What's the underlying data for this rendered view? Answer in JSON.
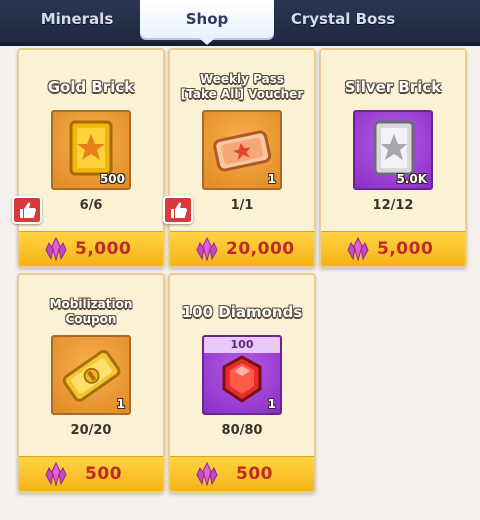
{
  "tabs": [
    {
      "label": "Minerals",
      "active": false
    },
    {
      "label": "Shop",
      "active": true
    },
    {
      "label": "Crystal Boss",
      "active": false
    }
  ],
  "items": [
    {
      "title": "Gold Brick",
      "icon": "gold-brick-icon",
      "quantity": "500",
      "stock": "6/6",
      "price": "5,000",
      "recommended": true
    },
    {
      "title_lines": [
        "Weekly Pass",
        "[Take All] Voucher"
      ],
      "icon": "voucher-ticket-icon",
      "quantity": "1",
      "stock": "1/1",
      "price": "20,000",
      "recommended": true
    },
    {
      "title": "Silver Brick",
      "icon": "silver-brick-icon",
      "quantity": "5.0K",
      "stock": "12/12",
      "price": "5,000",
      "recommended": false
    },
    {
      "title_lines": [
        "Mobilization",
        "Coupon"
      ],
      "icon": "mobilization-coupon-icon",
      "quantity": "1",
      "stock": "20/20",
      "price": "500",
      "recommended": false
    },
    {
      "title": "100 Diamonds",
      "icon": "diamond-icon",
      "top_quantity": "100",
      "quantity": "1",
      "stock": "80/80",
      "price": "500",
      "recommended": false
    }
  ],
  "colors": {
    "price_text": "#c02a22",
    "price_bar": "#ffd445",
    "card_bg": "#fbf2d6",
    "crystal_currency": "#d24fd0"
  },
  "currency_icon": "pink-crystal-icon",
  "recommend_icon": "thumbs-up-icon"
}
